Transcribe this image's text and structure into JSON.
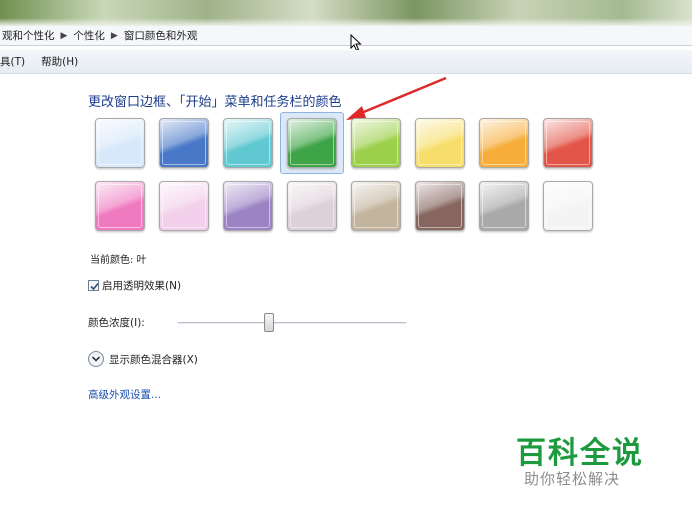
{
  "breadcrumb": {
    "items": [
      "观和个性化",
      "个性化",
      "窗口颜色和外观"
    ]
  },
  "menu": {
    "items": [
      "具(T)",
      "帮助(H)"
    ]
  },
  "section": {
    "title": "更改窗口边框、「开始」菜单和任务栏的颜色"
  },
  "swatches": {
    "selected_index": 3,
    "colors": [
      "#d7e8fb",
      "#4a78c9",
      "#5fc8d1",
      "#3ea447",
      "#9ccf4a",
      "#f7de6a",
      "#f6ad3a",
      "#e25548",
      "#f07ac0",
      "#f2cfea",
      "#9b83c4",
      "#ddd0d8",
      "#c2b49d",
      "#86665f",
      "#a9a9a9",
      "#f4f4f4"
    ]
  },
  "current_color": {
    "label": "当前颜色: 叶"
  },
  "transparency": {
    "label": "启用透明效果(N)",
    "checked": true
  },
  "intensity": {
    "label": "颜色浓度(I):",
    "value_fraction": 0.4
  },
  "mixer": {
    "label": "显示颜色混合器(X)"
  },
  "advanced": {
    "label": "高级外观设置..."
  },
  "watermark": {
    "title": "百科全说",
    "subtitle": "助你轻松解决"
  },
  "colors": {
    "title": "#1c3c8b",
    "link": "#1b4fb0",
    "arrow": "#e02a2a",
    "watermark": "#1d9a3e"
  }
}
